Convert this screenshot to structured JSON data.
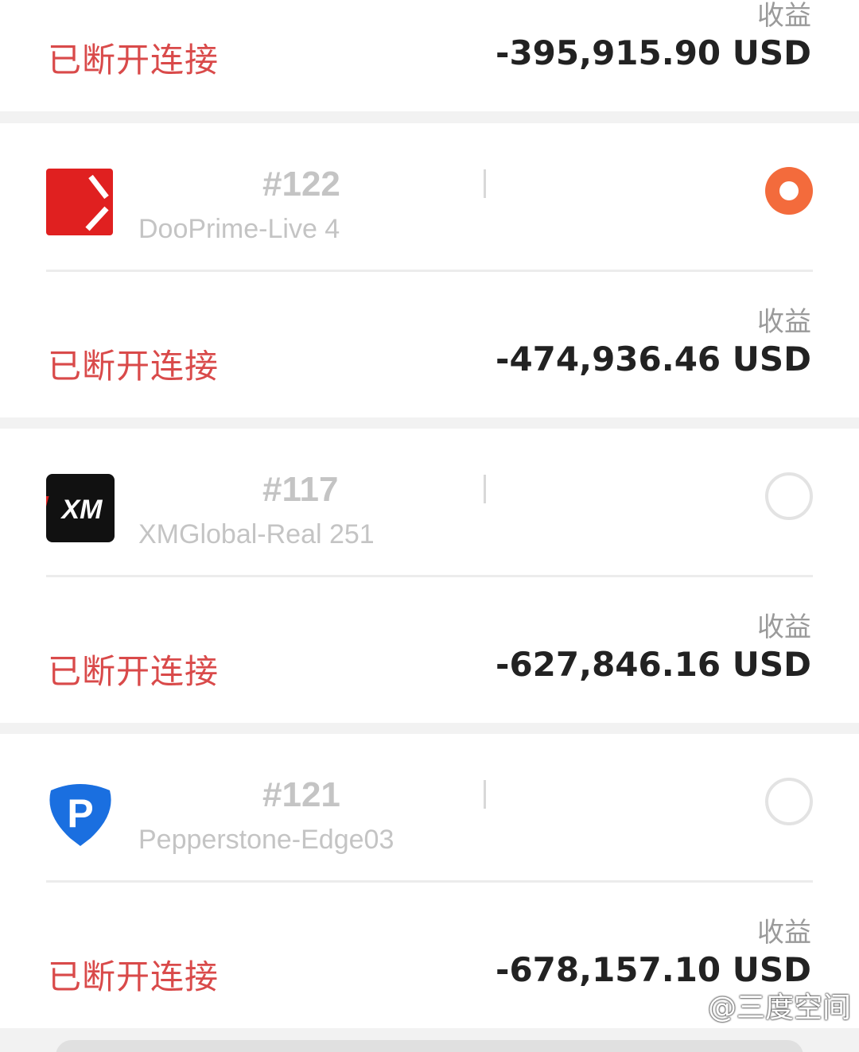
{
  "top_card": {
    "profit_label": "收益",
    "status": "已断开连接",
    "profit": "-395,915.90 USD"
  },
  "accounts": [
    {
      "number": "#122",
      "server": "DooPrime-Live 4",
      "status": "已断开连接",
      "profit_label": "收益",
      "profit": "-474,936.46 USD",
      "selected": true,
      "logo": "dooprime-logo"
    },
    {
      "number": "#117",
      "server": "XMGlobal-Real 251",
      "status": "已断开连接",
      "profit_label": "收益",
      "profit": "-627,846.16 USD",
      "selected": false,
      "logo": "xm-logo",
      "logo_text": "XM"
    },
    {
      "number": "#121",
      "server": "Pepperstone-Edge03",
      "status": "已断开连接",
      "profit_label": "收益",
      "profit": "-678,157.10 USD",
      "selected": false,
      "logo": "pepperstone-logo",
      "logo_text": "P"
    }
  ],
  "colors": {
    "status_red": "#d94a4a",
    "radio_selected": "#f36b3c",
    "dooprime_red": "#e02020",
    "pepperstone_blue": "#1a6fe0"
  },
  "watermark": {
    "text": "@三度空间"
  }
}
